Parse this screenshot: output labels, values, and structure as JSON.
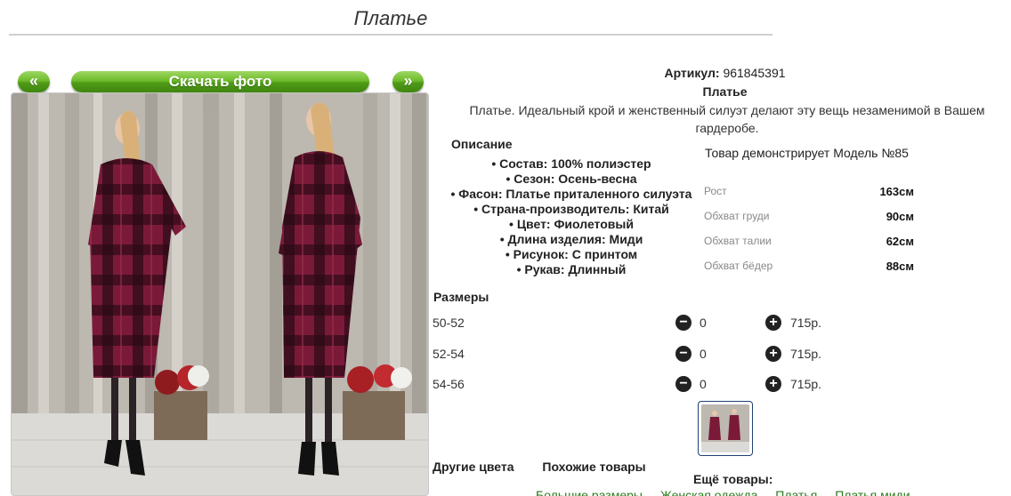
{
  "page": {
    "title": "Платье"
  },
  "gallery": {
    "prev_label": "«",
    "download_label": "Скачать фото",
    "next_label": "»"
  },
  "product": {
    "article_label": "Артикул:",
    "article_value": "961845391",
    "name": "Платье",
    "description": "Платье. Идеальный крой и женственный силуэт делают эту вещь незаменимой в Вашем гардеробе."
  },
  "description": {
    "heading": "Описание",
    "properties": [
      "• Состав: 100% полиэстер",
      "• Сезон: Осень-весна",
      "• Фасон: Платье приталенного силуэта",
      "• Страна-производитель: Китай",
      "• Цвет: Фиолетовый",
      "• Длина изделия: Миди",
      "• Рисунок: С принтом",
      "• Рукав: Длинный"
    ]
  },
  "model": {
    "heading": "Товар демонстрирует Модель №85",
    "measurements": [
      {
        "label": "Рост",
        "value": "163см"
      },
      {
        "label": "Обхват груди",
        "value": "90см"
      },
      {
        "label": "Обхват талии",
        "value": "62см"
      },
      {
        "label": "Обхват бёдер",
        "value": "88см"
      }
    ]
  },
  "sizes": {
    "heading": "Размеры",
    "rows": [
      {
        "size": "50-52",
        "qty": "0",
        "price": "715р."
      },
      {
        "size": "52-54",
        "qty": "0",
        "price": "715р."
      },
      {
        "size": "54-56",
        "qty": "0",
        "price": "715р."
      }
    ],
    "minus_symbol": "−",
    "plus_symbol": "+"
  },
  "bottom": {
    "tabs": [
      "Другие цвета",
      "Похожие товары"
    ],
    "more_heading": "Ещё товары:",
    "links": [
      "Большие размеры",
      "Женская одежда",
      "Платья",
      "Платья миди"
    ]
  },
  "colors": {
    "accent_green": "#6fbb2b",
    "dress": "#7a1a38",
    "link_green": "#2a7a1c"
  }
}
